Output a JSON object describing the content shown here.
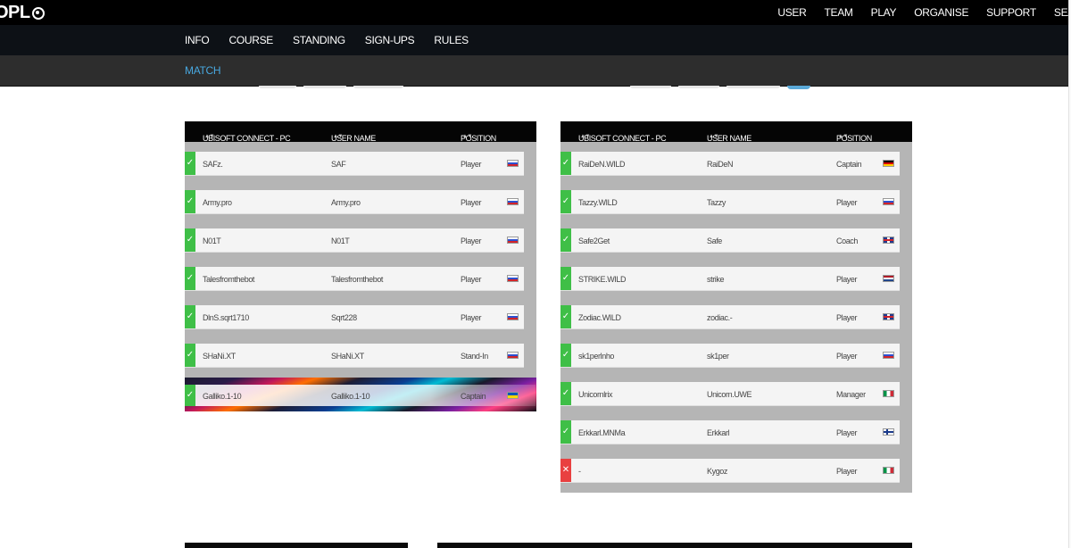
{
  "header": {
    "logo": "OPL",
    "nav": [
      "USER",
      "TEAM",
      "PLAY",
      "ORGANISE",
      "SUPPORT",
      "SEA"
    ]
  },
  "subnav": [
    "INFO",
    "COURSE",
    "STANDING",
    "SIGN-UPS",
    "RULES"
  ],
  "match_tab": "MATCH",
  "columns": {
    "account": "UBISOFT CONNECT - PC",
    "username": "USER NAME",
    "position": "POSITION",
    "sort_icon": "sort-icon"
  },
  "team_left": [
    {
      "account": "SAFz.",
      "username": "SAF",
      "position": "Player",
      "flag": "ru",
      "status": "ok"
    },
    {
      "account": "Army.pro",
      "username": "Army.pro",
      "position": "Player",
      "flag": "ru",
      "status": "ok"
    },
    {
      "account": "N01T",
      "username": "N01T",
      "position": "Player",
      "flag": "ru",
      "status": "ok"
    },
    {
      "account": "Talesfromthebot",
      "username": "Talesfromthebot",
      "position": "Player",
      "flag": "ru",
      "status": "ok"
    },
    {
      "account": "DlnS.sqrt1710",
      "username": "Sqrt228",
      "position": "Player",
      "flag": "ru",
      "status": "ok"
    },
    {
      "account": "SHaNi.XT",
      "username": "SHaNi.XT",
      "position": "Stand-In",
      "flag": "ru",
      "status": "ok"
    },
    {
      "account": "Galliko.1-10",
      "username": "Galliko.1-10",
      "position": "Captain",
      "flag": "ua",
      "status": "ok"
    }
  ],
  "team_right": [
    {
      "account": "RaiDeN.WILD",
      "username": "RaiDeN",
      "position": "Captain",
      "flag": "de",
      "status": "ok"
    },
    {
      "account": "Tazzy.WILD",
      "username": "Tazzy",
      "position": "Player",
      "flag": "ru",
      "status": "ok"
    },
    {
      "account": "Safe2Get",
      "username": "Safe",
      "position": "Coach",
      "flag": "gb",
      "status": "ok"
    },
    {
      "account": "STRIKE.WILD",
      "username": "strike",
      "position": "Player",
      "flag": "nl",
      "status": "ok"
    },
    {
      "account": "Zodiac.WILD",
      "username": "zodiac.-",
      "position": "Player",
      "flag": "gb",
      "status": "ok"
    },
    {
      "account": "sk1perlnho",
      "username": "sk1per",
      "position": "Player",
      "flag": "ru",
      "status": "ok"
    },
    {
      "account": "Unicornlrix",
      "username": "Unicorn.UWE",
      "position": "Manager",
      "flag": "it",
      "status": "ok"
    },
    {
      "account": "Erkkarl.MNMa",
      "username": "Erkkarl",
      "position": "Player",
      "flag": "fi",
      "status": "ok"
    },
    {
      "account": "-",
      "username": "Kygoz",
      "position": "Player",
      "flag": "it",
      "status": "bad"
    }
  ],
  "colors": {
    "ok": "#3fbf47",
    "bad": "#e94040",
    "accent": "#48a8e0"
  }
}
